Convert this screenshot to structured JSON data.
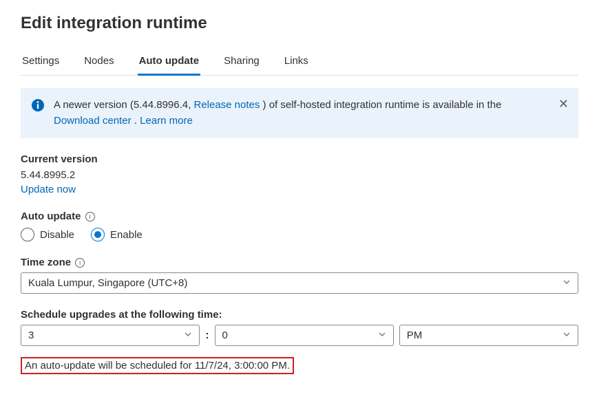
{
  "title": "Edit integration runtime",
  "tabs": [
    {
      "label": "Settings",
      "active": false
    },
    {
      "label": "Nodes",
      "active": false
    },
    {
      "label": "Auto update",
      "active": true
    },
    {
      "label": "Sharing",
      "active": false
    },
    {
      "label": "Links",
      "active": false
    }
  ],
  "banner": {
    "pre": "A newer version (5.44.8996.4, ",
    "release_notes": "Release notes",
    "mid": " ) of self-hosted integration runtime is available in the ",
    "download_center": "Download center",
    "sep": " . ",
    "learn_more": "Learn more"
  },
  "current_version": {
    "label": "Current version",
    "value": "5.44.8995.2",
    "update_now": "Update now"
  },
  "auto_update": {
    "label": "Auto update",
    "options": {
      "disable": "Disable",
      "enable": "Enable"
    },
    "selected": "enable"
  },
  "timezone": {
    "label": "Time zone",
    "value": "Kuala Lumpur, Singapore (UTC+8)"
  },
  "schedule": {
    "label": "Schedule upgrades at the following time:",
    "hour": "3",
    "minute": "0",
    "ampm": "PM"
  },
  "scheduled_text": "An auto-update will be scheduled for 11/7/24, 3:00:00 PM."
}
